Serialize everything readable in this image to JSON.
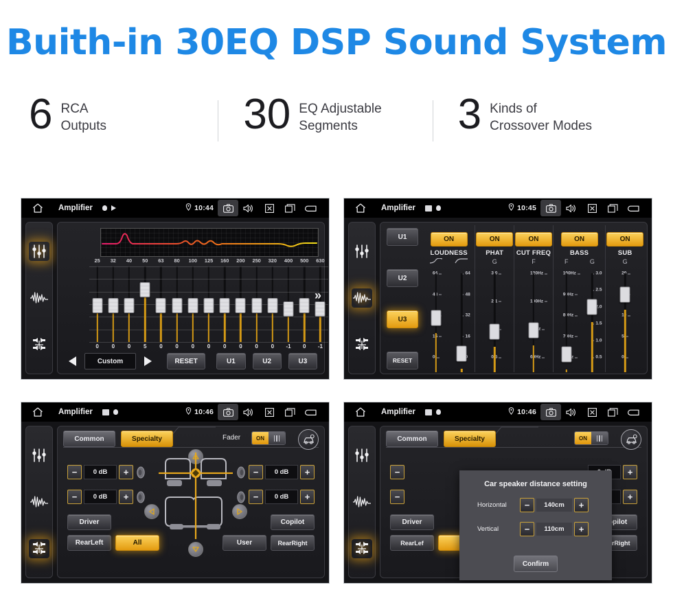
{
  "hero": {
    "title": "Buith-in 30EQ DSP Sound System",
    "stats": [
      {
        "number": "6",
        "line1": "RCA",
        "line2": "Outputs"
      },
      {
        "number": "30",
        "line1": "EQ Adjustable",
        "line2": "Segments"
      },
      {
        "number": "3",
        "line1": "Kinds of",
        "line2": "Crossover Modes"
      }
    ]
  },
  "accent_colors": {
    "title_blue": "#1e88e5",
    "amber": "#e39b10",
    "amber_light": "#fcd25c",
    "track_orange": "#d59a16",
    "screen_bg": "#141417"
  },
  "screens": {
    "eq": {
      "statusbar": {
        "home_icon": "home-icon",
        "title": "Amplifier",
        "mini_icons": [
          "record-dot-icon",
          "play-triangle-icon"
        ],
        "location_icon": "location-pin-icon",
        "clock": "10:44",
        "right_icons": [
          "camera-icon",
          "volume-icon",
          "close-box-icon",
          "recents-icon",
          "back-arrow-icon"
        ]
      },
      "rail_icons": [
        "equalizer-sliders-icon",
        "waveform-icon",
        "balance-fader-icon"
      ],
      "active_rail_index": 0,
      "graph": {
        "curve_colors": [
          "#e8196b",
          "#f07318",
          "#f2d01a"
        ]
      },
      "frequencies": [
        "25",
        "32",
        "40",
        "50",
        "63",
        "80",
        "100",
        "125",
        "160",
        "200",
        "250",
        "320",
        "400",
        "500",
        "630"
      ],
      "values": [
        "0",
        "0",
        "0",
        "5",
        "0",
        "0",
        "0",
        "0",
        "0",
        "0",
        "0",
        "0",
        "-1",
        "0",
        "-1"
      ],
      "preset": "Custom",
      "prev_label": "prev",
      "next_label": "next",
      "reset_label": "RESET",
      "user_presets": [
        "U1",
        "U2",
        "U3"
      ],
      "expand_icon": "double-chevron-right-icon"
    },
    "crossover": {
      "statusbar": {
        "title": "Amplifier",
        "clock": "10:45",
        "mini_icons": [
          "image-icon",
          "record-dot-icon"
        ],
        "right_icons": [
          "camera-icon",
          "volume-icon",
          "close-box-icon",
          "recents-icon",
          "back-arrow-icon"
        ]
      },
      "rail_icons": [
        "equalizer-sliders-icon",
        "waveform-icon",
        "balance-fader-icon"
      ],
      "active_rail_index": 1,
      "user_buttons": [
        "U1",
        "U2",
        "U3"
      ],
      "active_user": "U3",
      "reset_label": "RESET",
      "columns": [
        {
          "name": "LOUDNESS",
          "state": "ON",
          "wide": true,
          "sliders": [
            {
              "head": "curve-low-icon",
              "scale_side": "left",
              "scale": [
                "64",
                "48",
                "32",
                "16",
                "0"
              ],
              "value_pct": 47
            },
            {
              "head": "curve-high-icon",
              "scale_side": "right",
              "scale": [
                "64",
                "48",
                "32",
                "16",
                "0"
              ],
              "value_pct": 4
            }
          ]
        },
        {
          "name": "PHAT",
          "state": "ON",
          "wide": false,
          "sliders": [
            {
              "head": "G",
              "scale_side": "left",
              "scale": [
                "3.0",
                "2.1",
                "1.3",
                "0.5"
              ],
              "value_pct": 30
            }
          ]
        },
        {
          "name": "CUT FREQ",
          "state": "ON",
          "wide": false,
          "sliders": [
            {
              "head": "F",
              "scale_side": "left",
              "scale": [
                "120Hz",
                "100Hz",
                "80Hz",
                "60Hz"
              ],
              "value_pct": 32
            }
          ]
        },
        {
          "name": "BASS",
          "state": "ON",
          "wide": true,
          "sliders": [
            {
              "head": "F",
              "scale_side": "left",
              "scale": [
                "100Hz",
                "90Hz",
                "80Hz",
                "70Hz",
                "60Hz"
              ],
              "value_pct": 3
            },
            {
              "head": "G",
              "scale_side": "right",
              "scale": [
                "3.0",
                "2.5",
                "2.0",
                "1.5",
                "1.0",
                "0.5"
              ],
              "value_pct": 60
            }
          ]
        },
        {
          "name": "SUB",
          "state": "ON",
          "wide": false,
          "sliders": [
            {
              "head": "G",
              "scale_side": "left",
              "scale": [
                "20",
                "15",
                "10",
                "5",
                "0"
              ],
              "value_pct": 75
            }
          ]
        }
      ]
    },
    "fader": {
      "statusbar": {
        "title": "Amplifier",
        "clock": "10:46",
        "mini_icons": [
          "image-icon",
          "record-dot-icon"
        ],
        "right_icons": [
          "camera-icon",
          "volume-icon",
          "close-box-icon",
          "recents-icon",
          "back-arrow-icon"
        ]
      },
      "rail_icons": [
        "equalizer-sliders-icon",
        "waveform-icon",
        "balance-fader-icon"
      ],
      "active_rail_index": 2,
      "tabs": [
        {
          "label": "Common",
          "active": false
        },
        {
          "label": "Specialty",
          "active": true
        }
      ],
      "fader_label": "Fader",
      "fader_toggle": "ON",
      "car_setting_icon": "car-settings-icon",
      "gains": [
        {
          "position": "front-left",
          "value": "0 dB",
          "minus": "−",
          "plus": "+"
        },
        {
          "position": "rear-left",
          "value": "0 dB",
          "minus": "−",
          "plus": "+"
        },
        {
          "position": "front-right",
          "value": "0 dB",
          "minus": "−",
          "plus": "+"
        },
        {
          "position": "rear-right",
          "value": "0 dB",
          "minus": "−",
          "plus": "+"
        }
      ],
      "nav_icons": [
        "arrow-up-icon",
        "arrow-left-icon",
        "arrow-right-icon",
        "arrow-down-icon"
      ],
      "seat_diagram": "car-seats-diagram",
      "position_buttons": [
        {
          "label": "Driver",
          "active": false
        },
        {
          "label": "Copilot",
          "active": false
        },
        {
          "label": "RearLeft",
          "active": false
        },
        {
          "label": "All",
          "active": true
        },
        {
          "label": "User",
          "active": false
        },
        {
          "label": "RearRight",
          "active": false
        }
      ]
    },
    "dialog": {
      "statusbar": {
        "title": "Amplifier",
        "clock": "10:46",
        "mini_icons": [
          "image-icon",
          "record-dot-icon"
        ],
        "right_icons": [
          "camera-icon",
          "volume-icon",
          "close-box-icon",
          "recents-icon",
          "back-arrow-icon"
        ]
      },
      "rail_icons": [
        "equalizer-sliders-icon",
        "waveform-icon",
        "balance-fader-icon"
      ],
      "active_rail_index": 2,
      "tabs": [
        {
          "label": "Common",
          "active": false
        },
        {
          "label": "Specialty",
          "active": true
        }
      ],
      "fader_toggle": "ON",
      "car_setting_icon": "car-settings-icon",
      "gains": [
        {
          "position": "front-right",
          "value": "0 dB"
        },
        {
          "position": "rear-right",
          "value": "0 dB"
        }
      ],
      "position_buttons": [
        {
          "label": "Driver",
          "active": false
        },
        {
          "label": "Copilot",
          "active": false
        },
        {
          "label": "RearLef",
          "active": false
        },
        {
          "label": "RearRight",
          "active": false
        }
      ],
      "modal": {
        "title": "Car speaker distance setting",
        "rows": [
          {
            "label": "Horizontal",
            "value": "140cm",
            "minus": "−",
            "plus": "+"
          },
          {
            "label": "Vertical",
            "value": "110cm",
            "minus": "−",
            "plus": "+"
          }
        ],
        "confirm_label": "Confirm"
      }
    }
  }
}
